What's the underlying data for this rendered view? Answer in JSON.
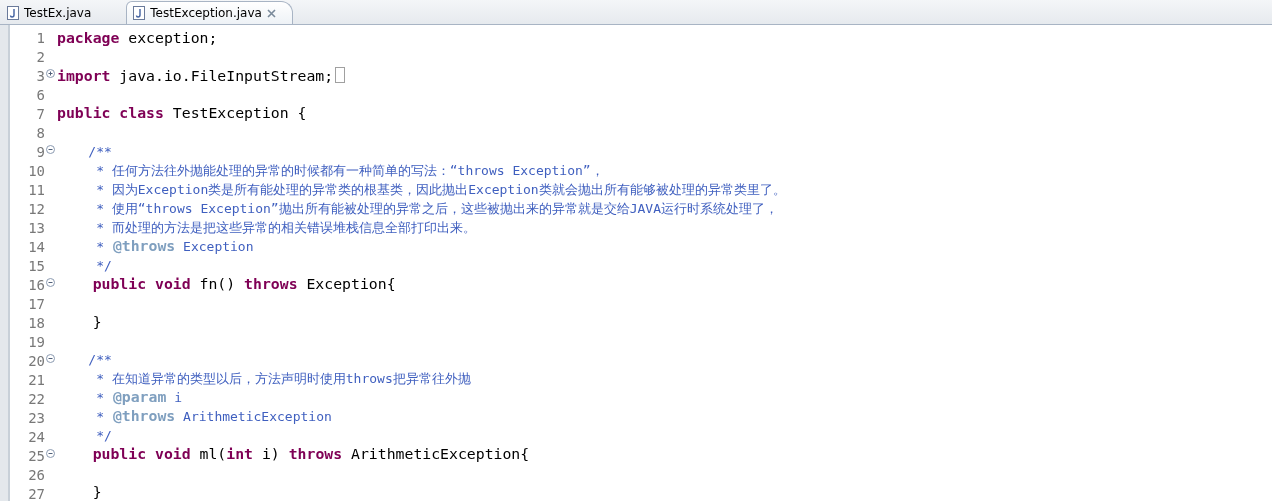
{
  "tabs": [
    {
      "label": "TestEx.java",
      "selected": false
    },
    {
      "label": "TestException.java",
      "selected": true
    }
  ],
  "lines": [
    {
      "number": "1",
      "tokens": [
        {
          "kind": "keyword",
          "text": "package"
        },
        {
          "kind": "plain",
          "text": " exception;"
        }
      ]
    },
    {
      "number": "2"
    },
    {
      "number": "3",
      "collapsed": true,
      "tokens": [
        {
          "kind": "keyword",
          "text": "import"
        },
        {
          "kind": "plain",
          "text": " java.io.FileInputStream;"
        }
      ]
    },
    {
      "number": "6"
    },
    {
      "number": "7",
      "tokens": [
        {
          "kind": "keyword",
          "text": "public"
        },
        {
          "kind": "keyword",
          "text": " class"
        },
        {
          "kind": "plain",
          "text": " TestException {"
        }
      ]
    },
    {
      "number": "8"
    },
    {
      "number": "9",
      "collapsed": false,
      "tokens": [
        {
          "kind": "comment",
          "text": "    /**"
        }
      ]
    },
    {
      "number": "10",
      "tokens": [
        {
          "kind": "comment",
          "text": "     * 任何方法往外抛能处理的异常的时候都有一种简单的写法：“throws Exception”，"
        }
      ]
    },
    {
      "number": "11",
      "tokens": [
        {
          "kind": "comment",
          "text": "     * 因为Exception类是所有能处理的异常类的根基类，因此抛出Exception类就会抛出所有能够被处理的异常类里了。"
        }
      ]
    },
    {
      "number": "12",
      "tokens": [
        {
          "kind": "comment",
          "text": "     * 使用“throws Exception”抛出所有能被处理的异常之后，这些被抛出来的异常就是交给JAVA运行时系统处理了，"
        }
      ]
    },
    {
      "number": "13",
      "tokens": [
        {
          "kind": "comment",
          "text": "     * 而处理的方法是把这些异常的相关错误堆栈信息全部打印出来。"
        }
      ]
    },
    {
      "number": "14",
      "tokens": [
        {
          "kind": "comment",
          "text": "     *"
        },
        {
          "kind": "tag",
          "text": " @throws"
        },
        {
          "kind": "comment",
          "text": " Exception"
        }
      ]
    },
    {
      "number": "15",
      "tokens": [
        {
          "kind": "comment",
          "text": "     */"
        }
      ]
    },
    {
      "number": "16",
      "collapsed": false,
      "tokens": [
        {
          "kind": "keyword",
          "text": "    public"
        },
        {
          "kind": "keyword",
          "text": " void"
        },
        {
          "kind": "plain",
          "text": " fn()"
        },
        {
          "kind": "keyword",
          "text": " throws"
        },
        {
          "kind": "plain",
          "text": " Exception{"
        }
      ]
    },
    {
      "number": "17"
    },
    {
      "number": "18",
      "tokens": [
        {
          "kind": "plain",
          "text": "    }"
        }
      ]
    },
    {
      "number": "19"
    },
    {
      "number": "20",
      "collapsed": false,
      "tokens": [
        {
          "kind": "comment",
          "text": "    /**"
        }
      ]
    },
    {
      "number": "21",
      "tokens": [
        {
          "kind": "comment",
          "text": "     * 在知道异常的类型以后，方法声明时使用throws把异常往外抛"
        }
      ]
    },
    {
      "number": "22",
      "tokens": [
        {
          "kind": "comment",
          "text": "     *"
        },
        {
          "kind": "tag",
          "text": " @param"
        },
        {
          "kind": "comment",
          "text": " i"
        }
      ]
    },
    {
      "number": "23",
      "tokens": [
        {
          "kind": "comment",
          "text": "     *"
        },
        {
          "kind": "tag",
          "text": " @throws"
        },
        {
          "kind": "comment",
          "text": " ArithmeticException"
        }
      ]
    },
    {
      "number": "24",
      "tokens": [
        {
          "kind": "comment",
          "text": "     */"
        }
      ]
    },
    {
      "number": "25",
      "collapsed": false,
      "tokens": [
        {
          "kind": "keyword",
          "text": "    public"
        },
        {
          "kind": "keyword",
          "text": " void"
        },
        {
          "kind": "plain",
          "text": " ml("
        },
        {
          "kind": "keyword",
          "text": "int"
        },
        {
          "kind": "plain",
          "text": " i)"
        },
        {
          "kind": "keyword",
          "text": " throws"
        },
        {
          "kind": "plain",
          "text": " ArithmeticException{"
        }
      ]
    },
    {
      "number": "26"
    },
    {
      "number": "27",
      "tokens": [
        {
          "kind": "plain",
          "text": "    }"
        }
      ]
    }
  ]
}
